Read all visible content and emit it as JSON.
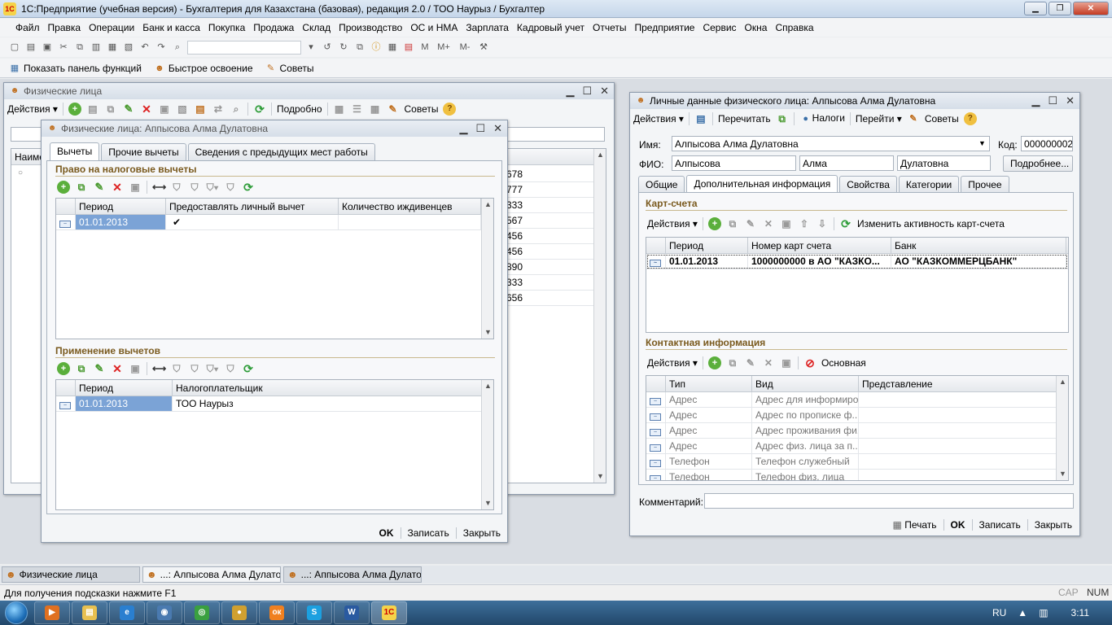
{
  "app": {
    "title": "1С:Предприятие (учебная версия) - Бухгалтерия для Казахстана (базовая), редакция 2.0 / ТОО Наурыз / Бухгалтер",
    "logo": "1С"
  },
  "menu": [
    "Файл",
    "Правка",
    "Операции",
    "Банк и касса",
    "Покупка",
    "Продажа",
    "Склад",
    "Производство",
    "ОС и НМА",
    "Зарплата",
    "Кадровый учет",
    "Отчеты",
    "Предприятие",
    "Сервис",
    "Окна",
    "Справка"
  ],
  "toolbar2": {
    "show_panel": "Показать панель функций",
    "quick_learn": "Быстрое освоение",
    "tips": "Советы"
  },
  "win_list": {
    "title": "Физические лица",
    "actions": "Действия",
    "details": "Подробно",
    "tips": "Советы",
    "col_name": "Наиме",
    "partial_values": [
      "678",
      "777",
      "333",
      "567",
      "456",
      "456",
      "890",
      "333",
      "656"
    ]
  },
  "win_deductions": {
    "title": "Физические лица: Аппысова Алма Дулатовна",
    "tabs": [
      "Вычеты",
      "Прочие вычеты",
      "Сведения с предыдущих мест работы"
    ],
    "section1": "Право на налоговые вычеты",
    "grid1": {
      "headers": [
        "Период",
        "Предоставлять личный вычет",
        "Количество иждивенцев"
      ],
      "rows": [
        {
          "period": "01.01.2013",
          "personal": "✔",
          "dependents": ""
        }
      ]
    },
    "section2": "Применение вычетов",
    "grid2": {
      "headers": [
        "Период",
        "Налогоплательщик"
      ],
      "rows": [
        {
          "period": "01.01.2013",
          "taxpayer": "ТОО Наурыз"
        }
      ]
    },
    "buttons": {
      "ok": "OK",
      "save": "Записать",
      "close": "Закрыть"
    }
  },
  "win_personal": {
    "title": "Личные данные физического лица: Алпысова Алма Дулатовна",
    "cmd": {
      "actions": "Действия",
      "reread": "Перечитать",
      "taxes": "Налоги",
      "goto": "Перейти",
      "tips": "Советы"
    },
    "name_label": "Имя:",
    "name_value": "Алпысова Алма Дулатовна",
    "code_label": "Код:",
    "code_value": "000000002",
    "fio_label": "ФИО:",
    "fio_last": "Алпысова",
    "fio_first": "Алма",
    "fio_middle": "Дулатовна",
    "more_button": "Подробнее...",
    "tabs": [
      "Общие",
      "Дополнительная информация",
      "Свойства",
      "Категории",
      "Прочее"
    ],
    "cards_section": "Карт-счета",
    "cards_actions": "Действия",
    "change_activity": "Изменить активность карт-счета",
    "cards_grid": {
      "headers": [
        "Период",
        "Номер карт счета",
        "Банк"
      ],
      "rows": [
        {
          "period": "01.01.2013",
          "number": "1000000000 в АО \"КАЗКО...",
          "bank": "АО \"КАЗКОММЕРЦБАНК\""
        }
      ]
    },
    "contact_section": "Контактная информация",
    "contact_actions": "Действия",
    "main_label": "Основная",
    "contact_grid": {
      "headers": [
        "Тип",
        "Вид",
        "Представление"
      ],
      "rows": [
        {
          "type": "Адрес",
          "kind": "Адрес для информиро...",
          "repr": ""
        },
        {
          "type": "Адрес",
          "kind": "Адрес по прописке ф...",
          "repr": ""
        },
        {
          "type": "Адрес",
          "kind": "Адрес проживания фи...",
          "repr": ""
        },
        {
          "type": "Адрес",
          "kind": "Адрес физ. лица за п...",
          "repr": ""
        },
        {
          "type": "Телефон",
          "kind": "Телефон служебный",
          "repr": ""
        },
        {
          "type": "Телефон",
          "kind": "Телефон физ. лица",
          "repr": ""
        }
      ]
    },
    "comment_label": "Комментарий:",
    "buttons": {
      "print": "Печать",
      "ok": "OK",
      "save": "Записать",
      "close": "Закрыть"
    }
  },
  "taskstrip": [
    "Физические лица",
    "...: Алпысова Алма Дулато...",
    "...: Аппысова Алма Дулато..."
  ],
  "status": {
    "hint": "Для получения подсказки нажмите F1",
    "cap": "CAP",
    "num": "NUM"
  },
  "tray": {
    "lang": "RU",
    "time": "3:11"
  }
}
